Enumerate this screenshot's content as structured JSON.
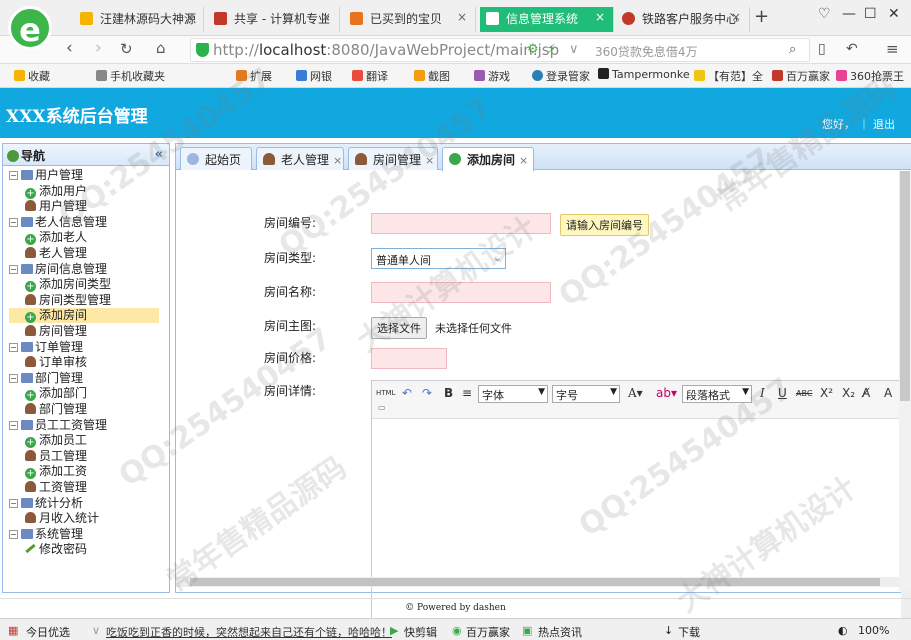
{
  "browser": {
    "tabs": [
      {
        "label": "汪建林源码大神源",
        "color": "#f4b400"
      },
      {
        "label": "共享 - 计算机专业",
        "color": "#c0392b"
      },
      {
        "label": "已买到的宝贝",
        "color": "#e8741e"
      },
      {
        "label": "信息管理系统",
        "color": "#ffffff"
      },
      {
        "label": "铁路客户服务中心",
        "color": "#c0392b"
      }
    ],
    "url_prefix": "http://",
    "url_host": "localhost",
    "url_rest": ":8080/JavaWebProject/main.jsp",
    "ad_text": "360贷款免息借4万",
    "bookmarks": [
      "收藏",
      "手机收藏夹",
      "扩展",
      "网银",
      "翻译",
      "截图",
      "游戏",
      "登录管家",
      "Tampermonke",
      "【有范】全",
      "百万赢家",
      "360抢票王"
    ]
  },
  "app": {
    "title": "XXX系统后台管理",
    "user_links": "您好，  ｜ 退出",
    "sidebar_title": "导航",
    "tree": [
      {
        "label": "用户管理",
        "type": "folder"
      },
      {
        "label": "添加用户",
        "type": "add"
      },
      {
        "label": "用户管理",
        "type": "user"
      },
      {
        "label": "老人信息管理",
        "type": "folder"
      },
      {
        "label": "添加老人",
        "type": "add"
      },
      {
        "label": "老人管理",
        "type": "user"
      },
      {
        "label": "房间信息管理",
        "type": "folder"
      },
      {
        "label": "添加房间类型",
        "type": "add"
      },
      {
        "label": "房间类型管理",
        "type": "user"
      },
      {
        "label": "添加房间",
        "type": "add",
        "selected": true
      },
      {
        "label": "房间管理",
        "type": "user"
      },
      {
        "label": "订单管理",
        "type": "folder"
      },
      {
        "label": "订单审核",
        "type": "user"
      },
      {
        "label": "部门管理",
        "type": "folder"
      },
      {
        "label": "添加部门",
        "type": "add"
      },
      {
        "label": "部门管理",
        "type": "user"
      },
      {
        "label": "员工工资管理",
        "type": "folder"
      },
      {
        "label": "添加员工",
        "type": "add"
      },
      {
        "label": "员工管理",
        "type": "user"
      },
      {
        "label": "添加工资",
        "type": "add"
      },
      {
        "label": "工资管理",
        "type": "user"
      },
      {
        "label": "统计分析",
        "type": "folder"
      },
      {
        "label": "月收入统计",
        "type": "user"
      },
      {
        "label": "系统管理",
        "type": "folder"
      },
      {
        "label": "修改密码",
        "type": "pen"
      }
    ],
    "tabs": [
      {
        "label": "起始页"
      },
      {
        "label": "老人管理"
      },
      {
        "label": "房间管理"
      },
      {
        "label": "添加房间"
      }
    ],
    "form": {
      "room_no_label": "房间编号:",
      "room_no_tip": "请输入房间编号",
      "room_type_label": "房间类型:",
      "room_type_value": "普通单人间",
      "room_name_label": "房间名称:",
      "room_image_label": "房间主图:",
      "file_button": "选择文件",
      "file_status": "未选择任何文件",
      "room_price_label": "房间价格:",
      "room_detail_label": "房间详情:"
    },
    "editor_toolbar": {
      "font_select": "字体",
      "size_select": "字号",
      "para_select": "段落格式"
    },
    "footer": "© Powered by dashen"
  },
  "statusbar": {
    "left": "今日优选",
    "news": "吃饭吃到正香的时候，突然想起来自己还有个链，哈哈哈！",
    "items": [
      "快剪辑",
      "百万赢家",
      "热点资讯",
      "下载"
    ],
    "zoom": "100%"
  },
  "watermarks": [
    "QQ:254540457",
    "常年售精品源码",
    "大神计算机设计"
  ]
}
